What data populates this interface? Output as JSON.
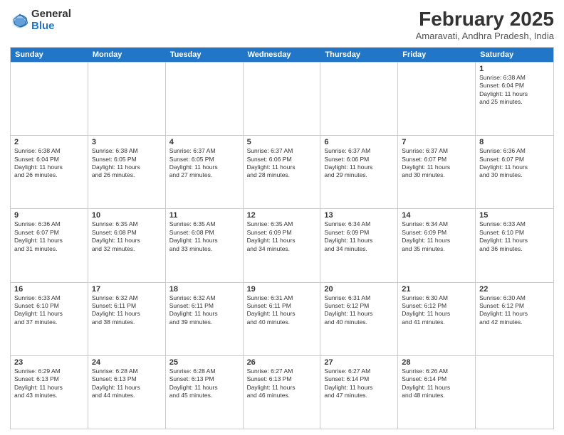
{
  "header": {
    "logo_general": "General",
    "logo_blue": "Blue",
    "month_year": "February 2025",
    "location": "Amaravati, Andhra Pradesh, India"
  },
  "day_headers": [
    "Sunday",
    "Monday",
    "Tuesday",
    "Wednesday",
    "Thursday",
    "Friday",
    "Saturday"
  ],
  "weeks": [
    {
      "days": [
        {
          "num": "",
          "info": ""
        },
        {
          "num": "",
          "info": ""
        },
        {
          "num": "",
          "info": ""
        },
        {
          "num": "",
          "info": ""
        },
        {
          "num": "",
          "info": ""
        },
        {
          "num": "",
          "info": ""
        },
        {
          "num": "1",
          "info": "Sunrise: 6:38 AM\nSunset: 6:04 PM\nDaylight: 11 hours\nand 25 minutes."
        }
      ]
    },
    {
      "days": [
        {
          "num": "2",
          "info": "Sunrise: 6:38 AM\nSunset: 6:04 PM\nDaylight: 11 hours\nand 26 minutes."
        },
        {
          "num": "3",
          "info": "Sunrise: 6:38 AM\nSunset: 6:05 PM\nDaylight: 11 hours\nand 26 minutes."
        },
        {
          "num": "4",
          "info": "Sunrise: 6:37 AM\nSunset: 6:05 PM\nDaylight: 11 hours\nand 27 minutes."
        },
        {
          "num": "5",
          "info": "Sunrise: 6:37 AM\nSunset: 6:06 PM\nDaylight: 11 hours\nand 28 minutes."
        },
        {
          "num": "6",
          "info": "Sunrise: 6:37 AM\nSunset: 6:06 PM\nDaylight: 11 hours\nand 29 minutes."
        },
        {
          "num": "7",
          "info": "Sunrise: 6:37 AM\nSunset: 6:07 PM\nDaylight: 11 hours\nand 30 minutes."
        },
        {
          "num": "8",
          "info": "Sunrise: 6:36 AM\nSunset: 6:07 PM\nDaylight: 11 hours\nand 30 minutes."
        }
      ]
    },
    {
      "days": [
        {
          "num": "9",
          "info": "Sunrise: 6:36 AM\nSunset: 6:07 PM\nDaylight: 11 hours\nand 31 minutes."
        },
        {
          "num": "10",
          "info": "Sunrise: 6:35 AM\nSunset: 6:08 PM\nDaylight: 11 hours\nand 32 minutes."
        },
        {
          "num": "11",
          "info": "Sunrise: 6:35 AM\nSunset: 6:08 PM\nDaylight: 11 hours\nand 33 minutes."
        },
        {
          "num": "12",
          "info": "Sunrise: 6:35 AM\nSunset: 6:09 PM\nDaylight: 11 hours\nand 34 minutes."
        },
        {
          "num": "13",
          "info": "Sunrise: 6:34 AM\nSunset: 6:09 PM\nDaylight: 11 hours\nand 34 minutes."
        },
        {
          "num": "14",
          "info": "Sunrise: 6:34 AM\nSunset: 6:09 PM\nDaylight: 11 hours\nand 35 minutes."
        },
        {
          "num": "15",
          "info": "Sunrise: 6:33 AM\nSunset: 6:10 PM\nDaylight: 11 hours\nand 36 minutes."
        }
      ]
    },
    {
      "days": [
        {
          "num": "16",
          "info": "Sunrise: 6:33 AM\nSunset: 6:10 PM\nDaylight: 11 hours\nand 37 minutes."
        },
        {
          "num": "17",
          "info": "Sunrise: 6:32 AM\nSunset: 6:11 PM\nDaylight: 11 hours\nand 38 minutes."
        },
        {
          "num": "18",
          "info": "Sunrise: 6:32 AM\nSunset: 6:11 PM\nDaylight: 11 hours\nand 39 minutes."
        },
        {
          "num": "19",
          "info": "Sunrise: 6:31 AM\nSunset: 6:11 PM\nDaylight: 11 hours\nand 40 minutes."
        },
        {
          "num": "20",
          "info": "Sunrise: 6:31 AM\nSunset: 6:12 PM\nDaylight: 11 hours\nand 40 minutes."
        },
        {
          "num": "21",
          "info": "Sunrise: 6:30 AM\nSunset: 6:12 PM\nDaylight: 11 hours\nand 41 minutes."
        },
        {
          "num": "22",
          "info": "Sunrise: 6:30 AM\nSunset: 6:12 PM\nDaylight: 11 hours\nand 42 minutes."
        }
      ]
    },
    {
      "days": [
        {
          "num": "23",
          "info": "Sunrise: 6:29 AM\nSunset: 6:13 PM\nDaylight: 11 hours\nand 43 minutes."
        },
        {
          "num": "24",
          "info": "Sunrise: 6:28 AM\nSunset: 6:13 PM\nDaylight: 11 hours\nand 44 minutes."
        },
        {
          "num": "25",
          "info": "Sunrise: 6:28 AM\nSunset: 6:13 PM\nDaylight: 11 hours\nand 45 minutes."
        },
        {
          "num": "26",
          "info": "Sunrise: 6:27 AM\nSunset: 6:13 PM\nDaylight: 11 hours\nand 46 minutes."
        },
        {
          "num": "27",
          "info": "Sunrise: 6:27 AM\nSunset: 6:14 PM\nDaylight: 11 hours\nand 47 minutes."
        },
        {
          "num": "28",
          "info": "Sunrise: 6:26 AM\nSunset: 6:14 PM\nDaylight: 11 hours\nand 48 minutes."
        },
        {
          "num": "",
          "info": ""
        }
      ]
    }
  ]
}
